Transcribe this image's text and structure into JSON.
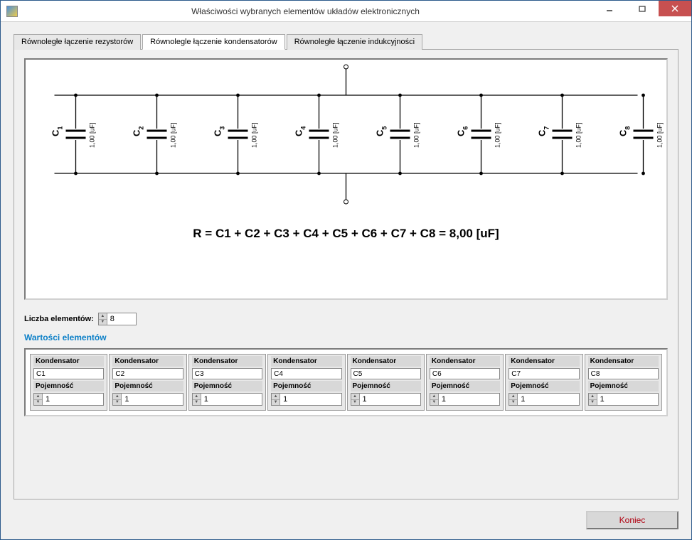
{
  "window": {
    "title": "Właściwości wybranych elementów układów elektronicznych"
  },
  "tabs": [
    {
      "label": "Równoległe łączenie rezystorów",
      "active": false
    },
    {
      "label": "Równolegle łączenie kondensatorów",
      "active": true
    },
    {
      "label": "Równoległe łączenie indukcyjności",
      "active": false
    }
  ],
  "circuit": {
    "capacitors": [
      {
        "name": "C",
        "sub": "1",
        "value": "1,00 [uF]"
      },
      {
        "name": "C",
        "sub": "2",
        "value": "1,00 [uF]"
      },
      {
        "name": "C",
        "sub": "3",
        "value": "1,00 [uF]"
      },
      {
        "name": "C",
        "sub": "4",
        "value": "1,00 [uF]"
      },
      {
        "name": "C",
        "sub": "5",
        "value": "1,00 [uF]"
      },
      {
        "name": "C",
        "sub": "6",
        "value": "1,00 [uF]"
      },
      {
        "name": "C",
        "sub": "7",
        "value": "1,00 [uF]"
      },
      {
        "name": "C",
        "sub": "8",
        "value": "1,00 [uF]"
      }
    ],
    "formula": "R = C1 + C2 + C3 + C4 + C5 + C6 + C7 + C8 = 8,00 [uF]"
  },
  "countRow": {
    "label": "Liczba elementów:",
    "value": "8"
  },
  "sectionTitle": "Wartości elementów",
  "elements": {
    "header1": "Kondensator",
    "header2": "Pojemność",
    "items": [
      {
        "name": "C1",
        "value": "1"
      },
      {
        "name": "C2",
        "value": "1"
      },
      {
        "name": "C3",
        "value": "1"
      },
      {
        "name": "C4",
        "value": "1"
      },
      {
        "name": "C5",
        "value": "1"
      },
      {
        "name": "C6",
        "value": "1"
      },
      {
        "name": "C7",
        "value": "1"
      },
      {
        "name": "C8",
        "value": "1"
      }
    ]
  },
  "footerButton": "Koniec"
}
